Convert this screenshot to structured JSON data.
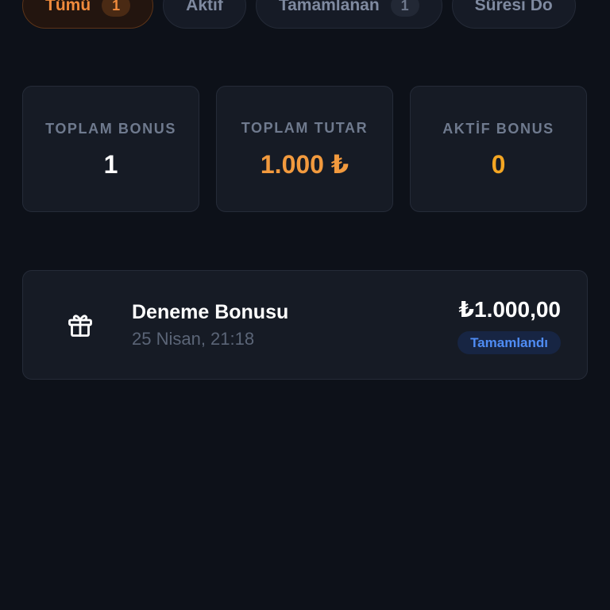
{
  "tabs": [
    {
      "label": "Tümü",
      "count": "1"
    },
    {
      "label": "Aktif",
      "count": ""
    },
    {
      "label": "Tamamlanan",
      "count": "1"
    },
    {
      "label": "Süresi Do",
      "count": ""
    }
  ],
  "stats": {
    "total_bonus": {
      "label": "TOPLAM BONUS",
      "value": "1"
    },
    "total_amount": {
      "label": "TOPLAM TUTAR",
      "value": "1.000 ₺"
    },
    "active_bonus": {
      "label": "AKTİF BONUS",
      "value": "0"
    }
  },
  "bonuses": [
    {
      "title": "Deneme Bonusu",
      "date": "25 Nisan, 21:18",
      "amount": "₺1.000,00",
      "status": "Tamamlandı",
      "icon": "gift-icon"
    }
  ],
  "colors": {
    "accent": "#f08a3c",
    "gold": "#f4a623",
    "status_blue": "#4f8cf4",
    "background": "#0d1119"
  }
}
